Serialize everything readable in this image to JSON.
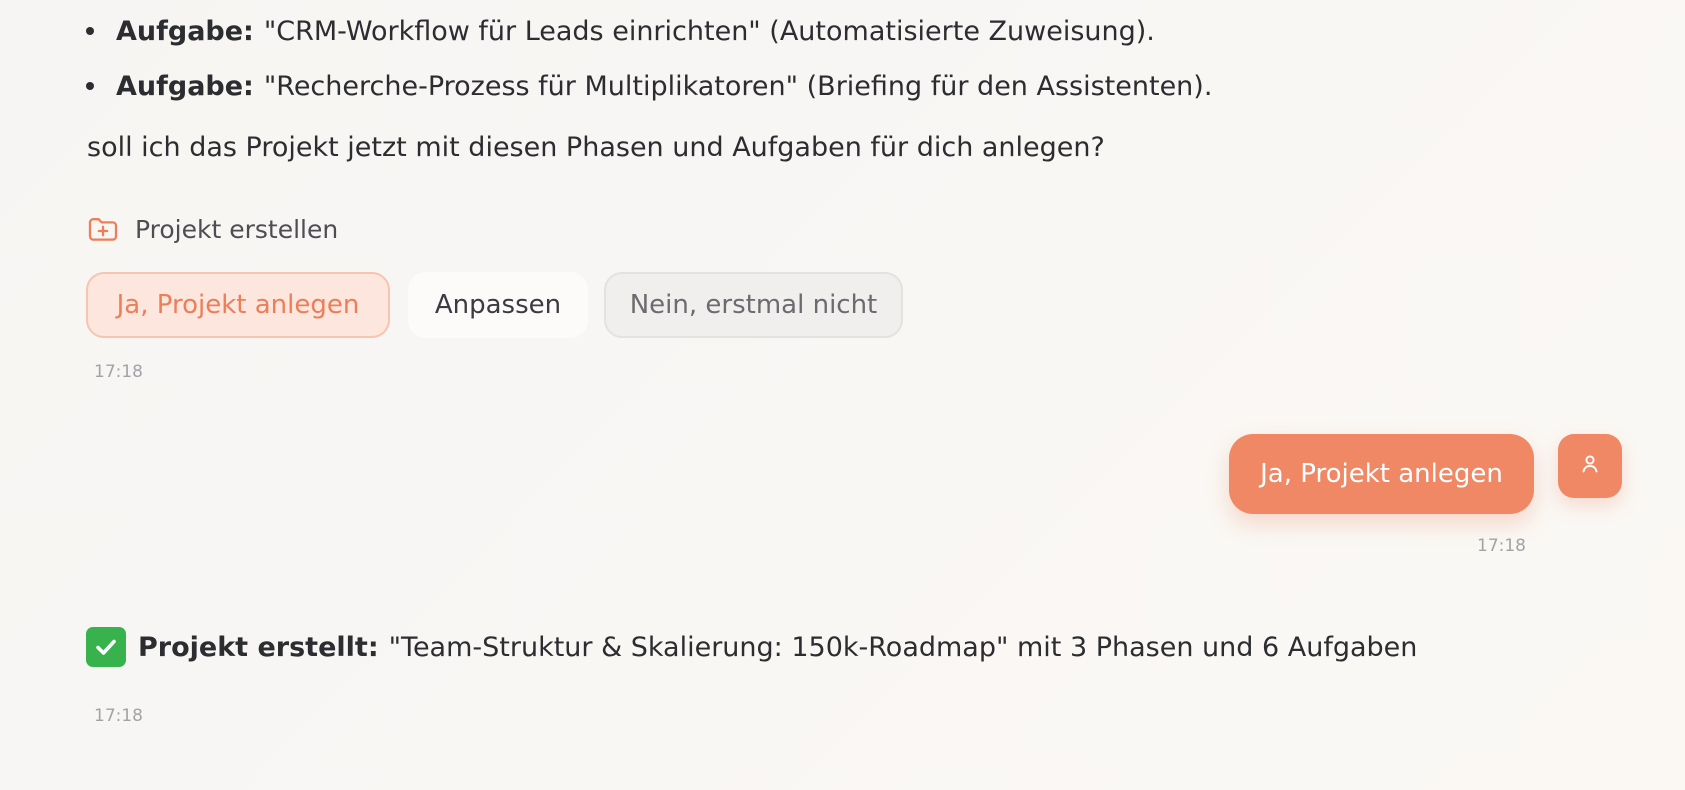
{
  "bullets": [
    {
      "label": "Aufgabe:",
      "text": "\"CRM-Workflow für Leads einrichten\" (Automatisierte Zuweisung)."
    },
    {
      "label": "Aufgabe:",
      "text": "\"Recherche-Prozess für Multiplikatoren\" (Briefing für den Assistenten)."
    }
  ],
  "question": "soll ich das Projekt jetzt mit diesen Phasen und Aufgaben für dich anlegen?",
  "tool": {
    "label": "Projekt erstellen",
    "icon": "folder-plus-icon"
  },
  "actions": {
    "confirm": "Ja, Projekt anlegen",
    "adjust": "Anpassen",
    "decline": "Nein, erstmal nicht"
  },
  "assistant_time_1": "17:18",
  "user_message": {
    "text": "Ja, Projekt anlegen",
    "time": "17:18",
    "avatar_icon": "user-icon"
  },
  "result": {
    "icon": "check-mark-button-icon",
    "label": "Projekt erstellt:",
    "text": "\"Team-Struktur & Skalierung: 150k-Roadmap\" mit 3 Phasen und 6 Aufgaben",
    "time": "17:18"
  },
  "colors": {
    "accent": "#f08866",
    "accent_soft": "#fde6dd",
    "text": "#2c2d31",
    "muted": "#a3a3a6",
    "success": "#37b24d"
  }
}
